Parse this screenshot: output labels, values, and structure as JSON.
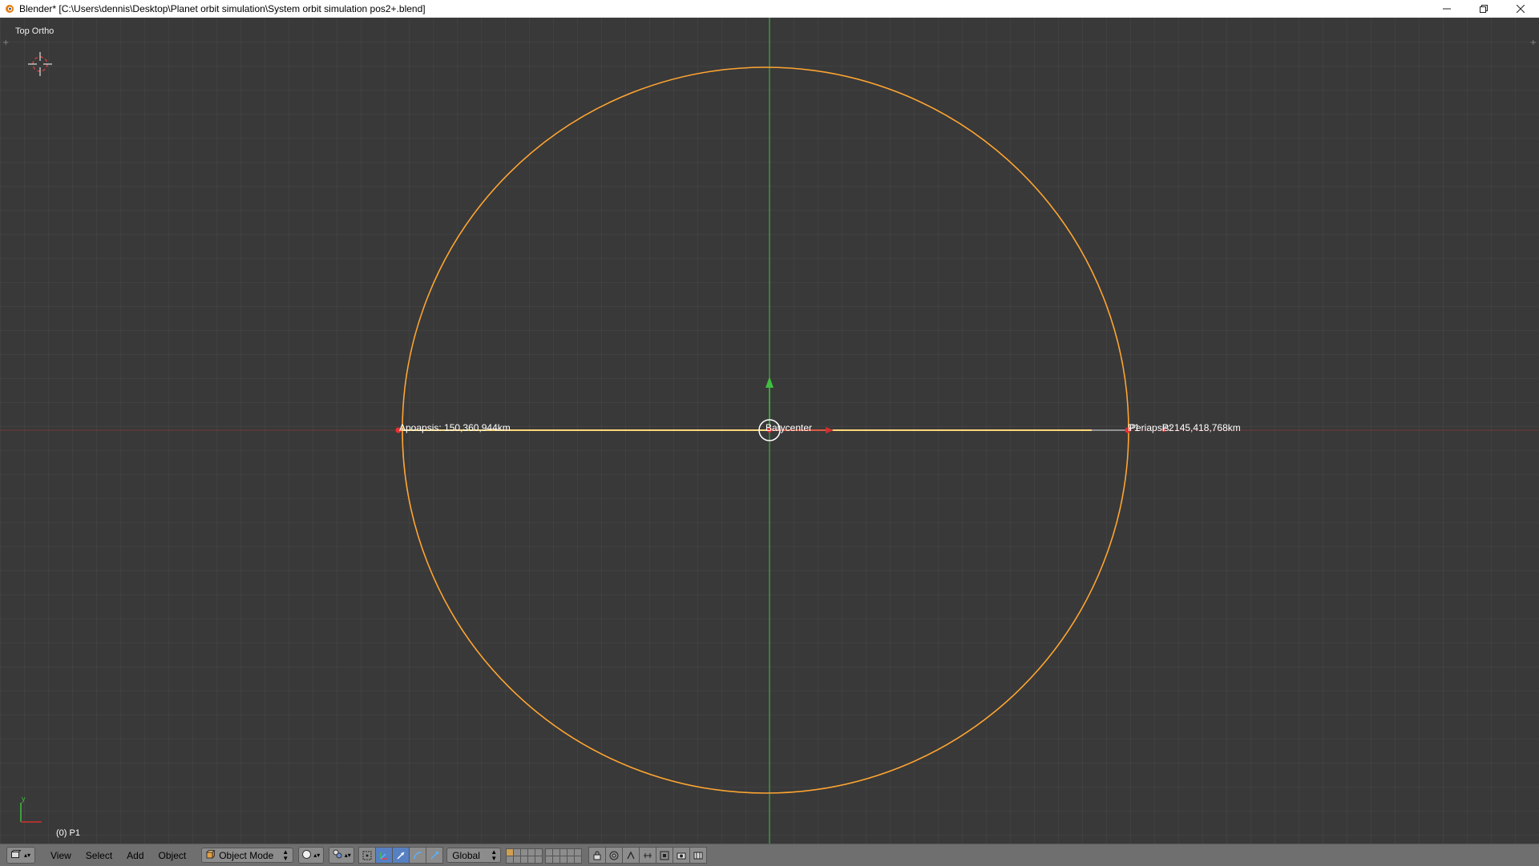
{
  "window": {
    "title": "Blender* [C:\\Users\\dennis\\Desktop\\Planet orbit simulation\\System orbit simulation pos2+.blend]",
    "app_icon": "blender-logo-icon",
    "controls": [
      "minimize-icon",
      "restore-icon",
      "close-icon"
    ]
  },
  "viewport": {
    "view_name": "Top Ortho",
    "frame_object": "(0) P1",
    "labels": {
      "apoapsis": "Apoapsis: 150,360,944km",
      "barycenter": "Barycenter",
      "p1": "P1",
      "periapsis": "Periapsis: 145,418,768km",
      "p2": "P2"
    },
    "axis_gizmo": {
      "y": "y"
    },
    "colors": {
      "orbit": "#ffa531",
      "selected_line": "#ffd87a",
      "y_axis": "#3fbf3f",
      "x_axis": "#c03030",
      "background": "#393939"
    }
  },
  "header": {
    "editor_type_icon": "3d-view-icon",
    "menus": [
      "View",
      "Select",
      "Add",
      "Object"
    ],
    "mode": "Object Mode",
    "orientation": "Global"
  }
}
